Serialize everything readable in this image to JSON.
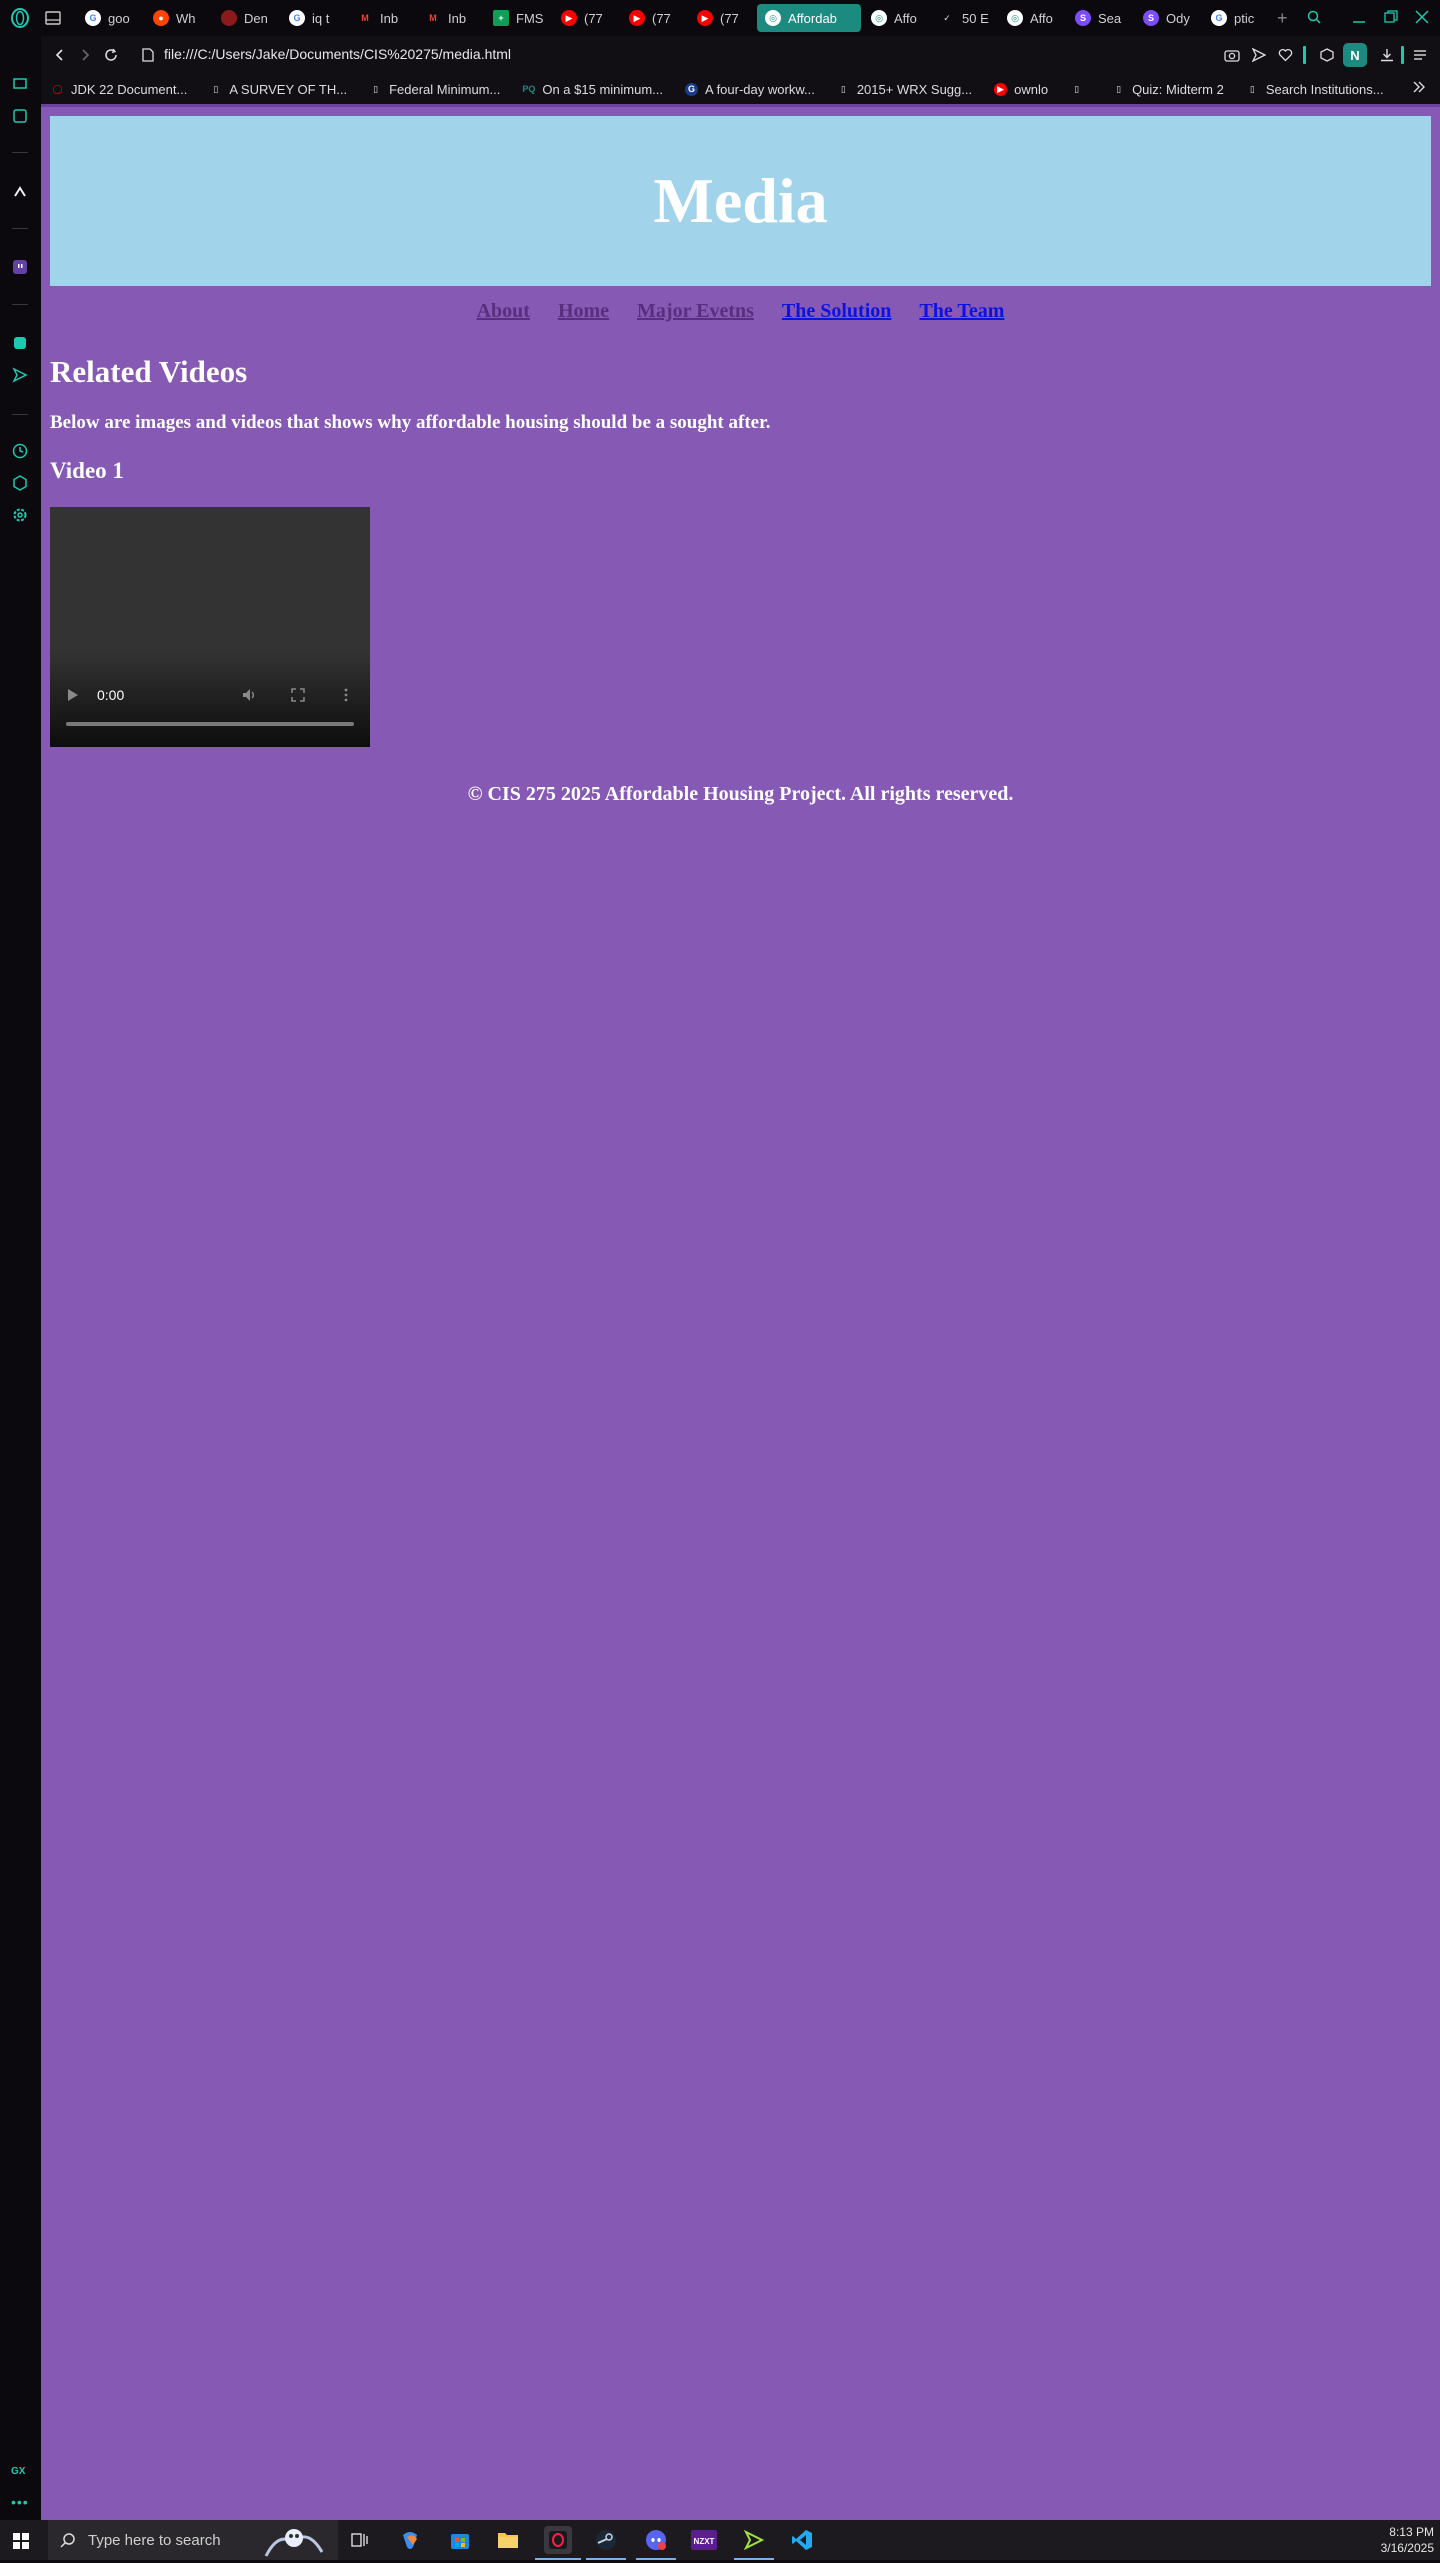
{
  "browser": {
    "tabs": [
      {
        "label": "goo",
        "icon": "google-icon"
      },
      {
        "label": "Wh",
        "icon": "reddit-icon"
      },
      {
        "label": "Den",
        "icon": "red-circle-icon"
      },
      {
        "label": "iq t",
        "icon": "google-icon"
      },
      {
        "label": "Inb",
        "icon": "gmail-icon"
      },
      {
        "label": "Inb",
        "icon": "gmail-icon"
      },
      {
        "label": "FMS",
        "icon": "sheets-icon"
      },
      {
        "label": "(77",
        "icon": "youtube-icon"
      },
      {
        "label": "(77",
        "icon": "youtube-icon"
      },
      {
        "label": "(77",
        "icon": "youtube-icon"
      },
      {
        "label": "Affordab",
        "icon": "globe-icon",
        "active": true
      },
      {
        "label": "Affo",
        "icon": "globe-icon"
      },
      {
        "label": "50 E",
        "icon": "check-circle-icon"
      },
      {
        "label": "Affo",
        "icon": "globe-icon"
      },
      {
        "label": "Sea",
        "icon": "s-logo-icon"
      },
      {
        "label": "Ody",
        "icon": "s-logo-icon"
      },
      {
        "label": "ptic",
        "icon": "google-icon"
      }
    ],
    "url": "file:///C:/Users/Jake/Documents/CIS%20275/media.html",
    "profile_initial": "N",
    "bookmarks": [
      {
        "label": "JDK 22 Document...",
        "icon": "oracle-icon"
      },
      {
        "label": "A SURVEY OF TH...",
        "icon": "document-icon"
      },
      {
        "label": "Federal Minimum...",
        "icon": "document-icon"
      },
      {
        "label": "On a $15 minimum...",
        "icon": "pq-icon"
      },
      {
        "label": "A four-day workw...",
        "icon": "g-icon"
      },
      {
        "label": "2015+ WRX Sugg...",
        "icon": "document-icon"
      },
      {
        "label": "ownlo",
        "icon": "youtube-icon"
      },
      {
        "label": "",
        "icon": "document-icon"
      },
      {
        "label": "Quiz: Midterm 2",
        "icon": "document-icon"
      },
      {
        "label": "Search Institutions...",
        "icon": "document-icon"
      }
    ],
    "sidebar_bottom_label": "GX",
    "accent": "#1c8a7f"
  },
  "page": {
    "banner_title": "Media",
    "nav": [
      {
        "label": "About",
        "state": "visited"
      },
      {
        "label": "Home",
        "state": "visited"
      },
      {
        "label": "Major Evetns",
        "state": "visited"
      },
      {
        "label": "The Solution",
        "state": "unvisited"
      },
      {
        "label": "The Team",
        "state": "unvisited"
      }
    ],
    "heading": "Related Videos",
    "intro": "Below are images and videos that shows why affordable housing should be a sought after.",
    "video_heading": "Video 1",
    "video_time": "0:00",
    "footer": "© CIS 275 2025 Affordable Housing Project. All rights reserved.",
    "colors": {
      "background": "#8559b4",
      "banner": "#a1d3ea"
    }
  },
  "taskbar": {
    "search_placeholder": "Type here to search",
    "time": "8:13 PM",
    "date": "3/16/2025"
  }
}
